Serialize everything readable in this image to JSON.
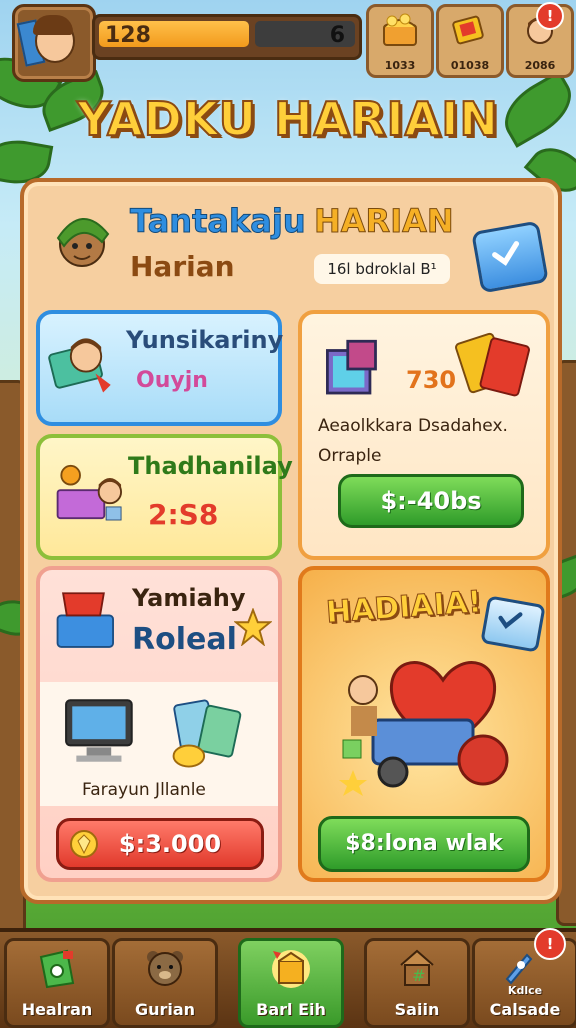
{
  "top_bar": {
    "xp_left": "128",
    "xp_right": "6",
    "xp_progress": 0.6,
    "resources": [
      {
        "name": "chest-icon",
        "label": "1033"
      },
      {
        "name": "ticket-icon",
        "label": "01038"
      },
      {
        "name": "friend-icon",
        "label": "2086",
        "badge": "!"
      }
    ]
  },
  "title": "YADKU HARIAIN",
  "header": {
    "title_a": "Tantakaju",
    "title_b": "HARIAN",
    "subtitle": "Harian",
    "pill": "16l bdroklal B¹"
  },
  "cards": {
    "blue": {
      "title": "Yunsikariny",
      "sub": "Ouyjn"
    },
    "yellow": {
      "title": "Thadhanilay",
      "timer": "2:S8"
    },
    "cube_offer": {
      "amount": "730",
      "desc1": "Aeaolkkara Dsadahex.",
      "desc2": "Orraple",
      "price": "$:-40bs"
    },
    "pink": {
      "title": "Yamiahy",
      "sub": "Roleal",
      "caption": "Farayun Jllanle",
      "price": "$:3.000"
    },
    "special": {
      "title": "HADIAIA!",
      "button": "$8:lona wlak"
    }
  },
  "nav": [
    {
      "name": "nav-healran",
      "label": "Healran"
    },
    {
      "name": "nav-gurian",
      "label": "Gurian"
    },
    {
      "name": "nav-barl-eih",
      "label": "Barl Eih"
    },
    {
      "name": "nav-saiin",
      "label": "Saiin"
    },
    {
      "name": "nav-calsade",
      "label_top": "Kdlce",
      "label": "Calsade",
      "badge": "!"
    }
  ],
  "colors": {
    "accent": "#f5b026",
    "panel": "#f6cfa0",
    "green": "#2f9c2a",
    "red": "#e13a2c",
    "blue": "#3d8fe0"
  }
}
